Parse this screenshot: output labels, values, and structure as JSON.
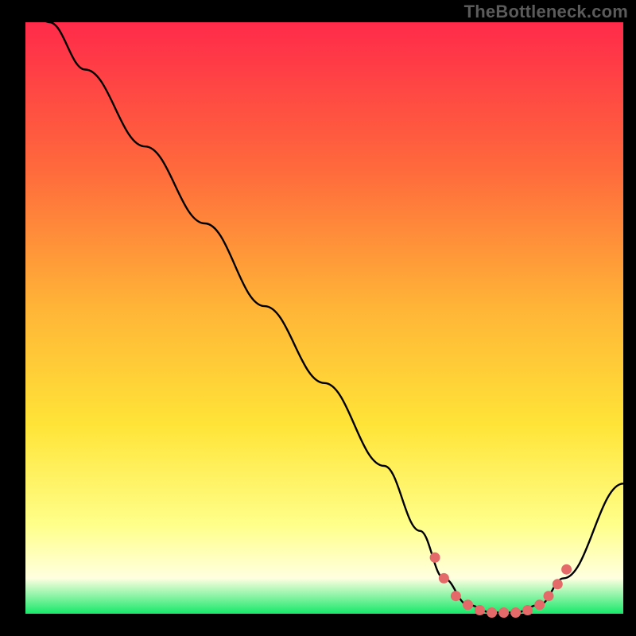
{
  "watermark": "TheBottleneck.com",
  "colors": {
    "background": "#000000",
    "gradient_top": "#ff2a4a",
    "gradient_mid1": "#ff6a3c",
    "gradient_mid2": "#ffb437",
    "gradient_mid3": "#ffe437",
    "gradient_pale1": "#ffff8a",
    "gradient_pale2": "#ffffe0",
    "gradient_bottom": "#17e86a",
    "curve": "#000000",
    "dots": "#e46a6a"
  },
  "chart_data": {
    "type": "line",
    "title": "",
    "xlabel": "",
    "ylabel": "",
    "xlim": [
      0,
      100
    ],
    "ylim": [
      0,
      100
    ],
    "series": [
      {
        "name": "bottleneck-curve",
        "x": [
          0,
          4,
          10,
          20,
          30,
          40,
          50,
          60,
          66,
          70,
          74,
          78,
          82,
          86,
          90,
          100
        ],
        "y": [
          103,
          100,
          92,
          79,
          66,
          52,
          39,
          25,
          14,
          6,
          1.5,
          0.2,
          0.2,
          1.5,
          6,
          22
        ]
      }
    ],
    "sweet_spot_markers": {
      "name": "sweet-spot-dots",
      "x": [
        68.5,
        70,
        72,
        74,
        76,
        78,
        80,
        82,
        84,
        86,
        87.5,
        89,
        90.5
      ],
      "y": [
        9.5,
        6,
        3,
        1.5,
        0.6,
        0.2,
        0.2,
        0.2,
        0.6,
        1.5,
        3,
        5,
        7.5
      ]
    }
  }
}
